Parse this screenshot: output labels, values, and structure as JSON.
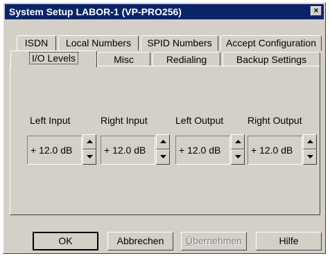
{
  "window": {
    "title": "System Setup  LABOR-1 (VP-PRO256)",
    "close_symbol": "×"
  },
  "tabs_row1": [
    {
      "label": "ISDN"
    },
    {
      "label": "Local Numbers"
    },
    {
      "label": "SPID Numbers"
    },
    {
      "label": "Accept Configuration"
    }
  ],
  "tabs_row2": [
    {
      "label": "I/O Levels",
      "selected": true
    },
    {
      "label": "Misc"
    },
    {
      "label": "Redialing"
    },
    {
      "label": "Backup Settings"
    }
  ],
  "levels": [
    {
      "label": "Left Input",
      "value": "+ 12.0 dB"
    },
    {
      "label": "Right Input",
      "value": "+ 12.0 dB"
    },
    {
      "label": "Left Output",
      "value": "+ 12.0 dB"
    },
    {
      "label": "Right Output",
      "value": "+ 12.0 dB"
    }
  ],
  "buttons": {
    "ok": "OK",
    "cancel": "Abbrechen",
    "apply_prefix": "Ü",
    "apply_rest": "bernehmen",
    "help": "Hilfe"
  },
  "icons": {
    "spin_up": "up-arrow-icon",
    "spin_down": "down-arrow-icon"
  }
}
